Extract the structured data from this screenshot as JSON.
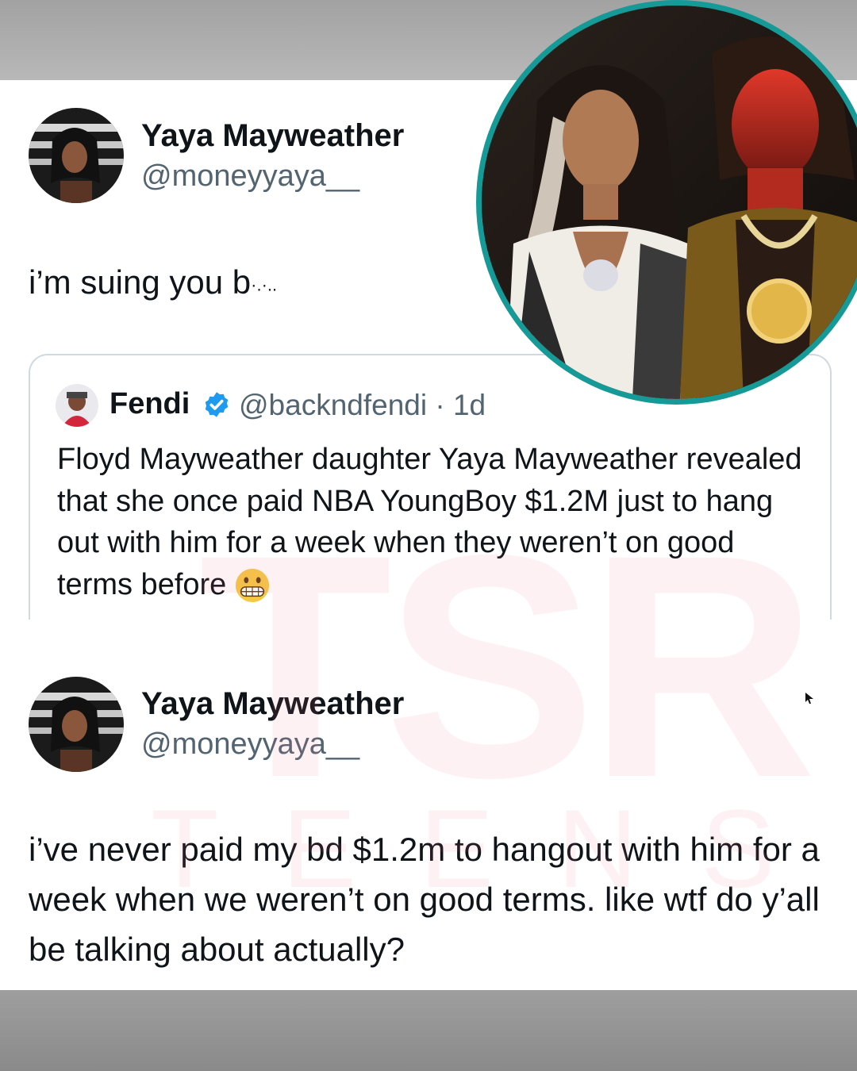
{
  "tweet1": {
    "name": "Yaya Mayweather",
    "handle": "@moneyyaya__",
    "text": "i’m suing you b"
  },
  "quote": {
    "name": "Fendi",
    "handle": "@backndfendi · 1d",
    "text": "Floyd Mayweather daughter Yaya Mayweather revealed that she once paid NBA YoungBoy $1.2M just to hang out with him for a week when they weren’t on good terms before",
    "emoji": "grimacing-face-emoji"
  },
  "tweet2": {
    "name": "Yaya Mayweather",
    "handle": "@moneyyaya__",
    "text": "i’ve never paid my bd $1.2m to hangout with him for a week when we weren’t on good terms. like wtf do y’all be talking about actually?"
  },
  "watermark": {
    "letters": "TSR",
    "sub": "TEENS"
  },
  "colors": {
    "verified": "#1d9bf0",
    "circle_border": "#169a98",
    "handle": "#536471"
  }
}
